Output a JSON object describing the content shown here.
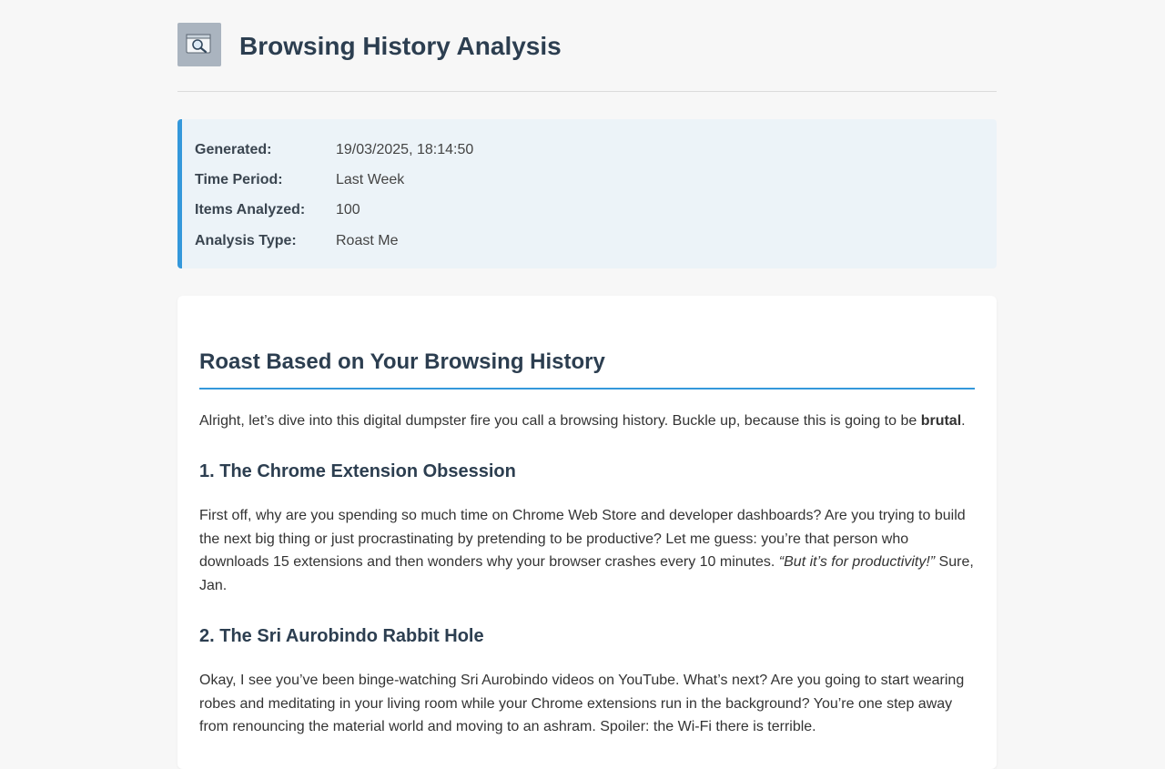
{
  "header": {
    "title": "Browsing History Analysis",
    "logo_icon": "magnifier-window-icon"
  },
  "meta": {
    "rows": [
      {
        "label": "Generated:",
        "value": "19/03/2025, 18:14:50"
      },
      {
        "label": "Time Period:",
        "value": "Last Week"
      },
      {
        "label": "Items Analyzed:",
        "value": "100"
      },
      {
        "label": "Analysis Type:",
        "value": "Roast Me"
      }
    ]
  },
  "report": {
    "title": "Roast Based on Your Browsing History",
    "intro_text": "Alright, let’s dive into this digital dumpster fire you call a browsing history. Buckle up, because this is going to be ",
    "intro_bold": "brutal",
    "intro_end": ".",
    "sections": [
      {
        "heading": "1. The Chrome Extension Obsession",
        "text": "First off, why are you spending so much time on Chrome Web Store and developer dashboards? Are you trying to build the next big thing or just procrastinating by pretending to be productive? Let me guess: you’re that person who downloads 15 extensions and then wonders why your browser crashes every 10 minutes. ",
        "italic": "“But it’s for productivity!”",
        "text_end": " Sure, Jan."
      },
      {
        "heading": "2. The Sri Aurobindo Rabbit Hole",
        "text": "Okay, I see you’ve been binge-watching Sri Aurobindo videos on YouTube. What’s next? Are you going to start wearing robes and meditating in your living room while your Chrome extensions run in the background? You’re one step away from renouncing the material world and moving to an ashram. Spoiler: the Wi-Fi there is terrible."
      }
    ]
  },
  "colors": {
    "accent": "#3498db",
    "heading": "#2c3e50",
    "meta_bg": "#ecf3f8",
    "page_bg": "#f7f7f7"
  }
}
